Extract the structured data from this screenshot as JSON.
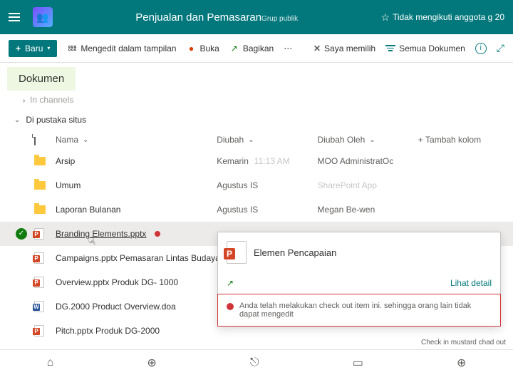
{
  "header": {
    "title": "Penjualan dan Pemasaran",
    "groupType": "Grup publik",
    "followText": "Tidak mengikuti anggota g 20"
  },
  "toolbar": {
    "newLabel": "Baru",
    "editInView": "Mengedit dalam tampilan",
    "open": "Buka",
    "share": "Bagikan",
    "selecting": "Saya memilih",
    "allDocs": "Semua Dokumen"
  },
  "section": {
    "documentsLabel": "Dokumen",
    "inChannels": "In channels",
    "inSiteLib": "Di pustaka situs"
  },
  "columns": {
    "name": "Nama",
    "modified": "Diubah",
    "modifiedBy": "Diubah Oleh",
    "addColumn": "Tambah kolom"
  },
  "rows": [
    {
      "type": "folder",
      "name": "Arsip",
      "modified": "Kemarin",
      "time": "11:13 AM",
      "by": "MOO AdministratOc"
    },
    {
      "type": "folder",
      "name": "Umum",
      "modified": "Agustus IS",
      "time": "",
      "by": "SharePoint App",
      "byFaded": true
    },
    {
      "type": "folder",
      "name": "Laporan Bulanan",
      "modified": "Agustus IS",
      "time": "",
      "by": "Megan Be-wen"
    },
    {
      "type": "ppt",
      "name": "Branding Elements.pptx",
      "selected": true,
      "checkedOut": true
    },
    {
      "type": "ppt",
      "name": "Campaigns.pptx Pemasaran Lintas Budaya"
    },
    {
      "type": "ppt",
      "name": "Overview.pptx Produk DG- 1000"
    },
    {
      "type": "word",
      "name": "DG.2000 Product Overview.doa"
    },
    {
      "type": "ppt",
      "name": "Pitch.pptx Produk DG-2000"
    }
  ],
  "hoverCard": {
    "title": "Elemen Pencapaian",
    "viewDetail": "Lihat detail",
    "warning": "Anda telah melakukan check out item ini. sehingga orang lain tidak dapat mengedit"
  },
  "footer": {
    "checkinNote": "Check in mustard chad out"
  }
}
